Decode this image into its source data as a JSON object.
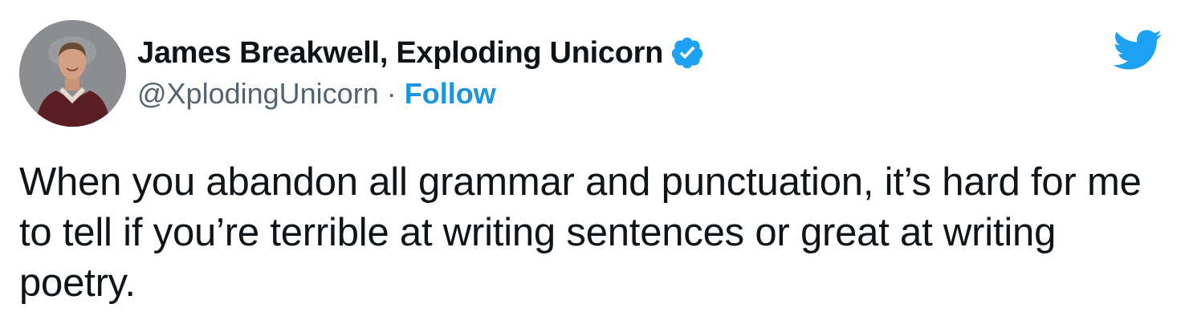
{
  "tweet": {
    "author": {
      "display_name": "James Breakwell, Exploding Unicorn",
      "handle": "@XplodingUnicorn",
      "verified": true,
      "avatar_icon": "profile-photo"
    },
    "separator": "·",
    "follow_label": "Follow",
    "text": "When you abandon all grammar and punctuation, it’s hard for me to tell if you’re terrible at writing sentences or great at writing poetry.",
    "brand_icon": "twitter-bird-icon"
  },
  "colors": {
    "brand_blue": "#1DA1F2",
    "follow_blue": "#1B95E0",
    "text_primary": "#0F1419",
    "text_secondary": "#536471"
  }
}
